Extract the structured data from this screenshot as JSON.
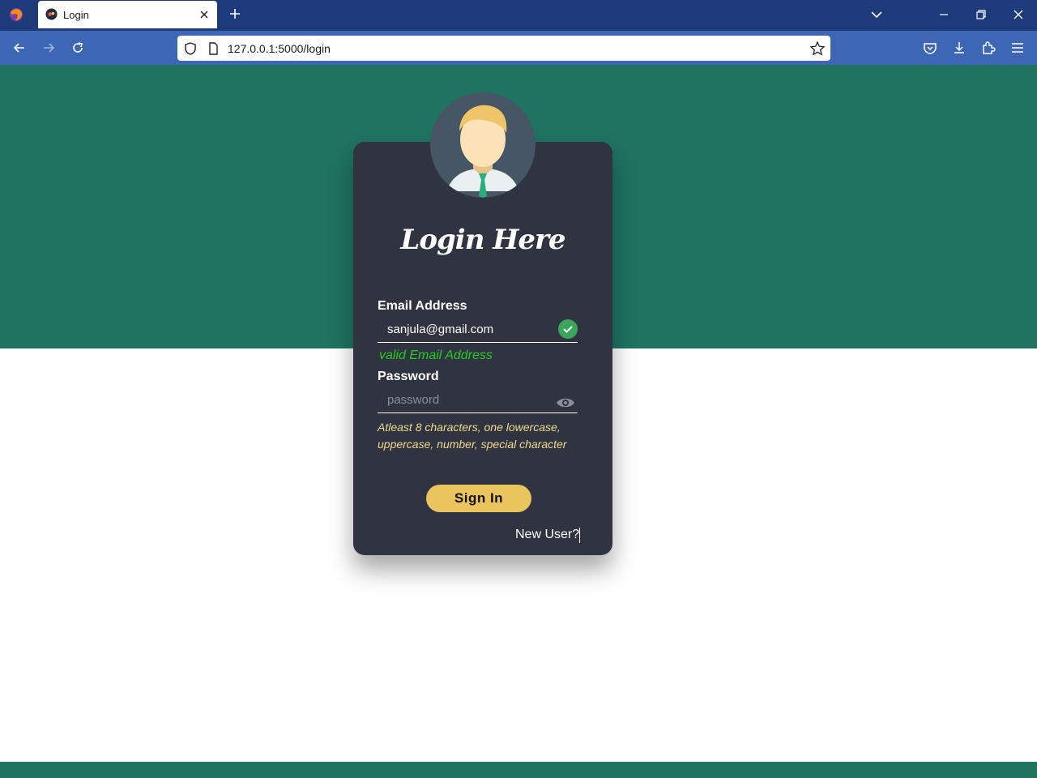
{
  "browser": {
    "tab_title": "Login",
    "url": "127.0.0.1:5000/login"
  },
  "login": {
    "heading": "Login Here",
    "email_label": "Email Address",
    "email_value": "sanjula@gmail.com",
    "email_valid_message": "valid Email Address",
    "password_label": "Password",
    "password_placeholder": "password",
    "password_hint": "Atleast 8 characters, one lowercase, uppercase, number, special character",
    "signin_label": "Sign In",
    "new_user_link": "New User?"
  },
  "colors": {
    "band": "#1f7360",
    "card": "#303440",
    "button": "#eac55d",
    "valid": "#22cc22",
    "hint": "#f0d890"
  }
}
